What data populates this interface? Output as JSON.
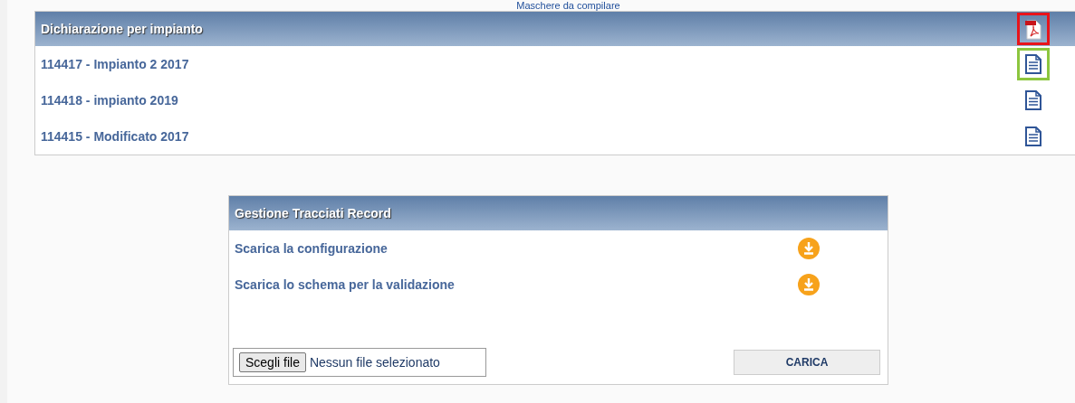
{
  "top_link": "Maschere da compilare",
  "declarations": {
    "title": "Dichiarazione per impianto",
    "header_icon": {
      "color": "#e8141b"
    },
    "rows": [
      {
        "label": "114417 - Impianto 2 2017",
        "color": "#8cc63f"
      },
      {
        "label": "114418 - impianto 2019"
      },
      {
        "label": "114415 - Modificato 2017"
      }
    ]
  },
  "records": {
    "title": "Gestione Tracciati Record",
    "rows": [
      {
        "label": "Scarica la configurazione"
      },
      {
        "label": "Scarica lo schema per la validazione"
      }
    ],
    "file_button": "Scegli file",
    "file_status": "Nessun file selezionato",
    "upload_button": "CARICA"
  }
}
